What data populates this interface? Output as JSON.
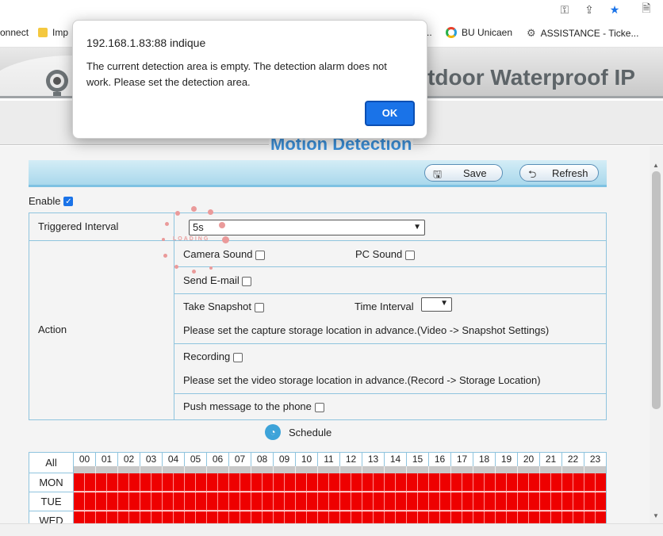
{
  "browser": {
    "bookmarks": [
      "onnect",
      "Imp",
      "..",
      "BU Unicaen",
      "ASSISTANCE - Ticke..."
    ],
    "accent": "#1a73e8"
  },
  "header": {
    "title": "utdoor Waterproof IP"
  },
  "section": {
    "title": "Motion Detection"
  },
  "toolbar": {
    "save_label": "Save",
    "refresh_label": "Refresh"
  },
  "form": {
    "enable_label": "Enable",
    "enable_checked": true,
    "triggered_interval_label": "Triggered Interval",
    "triggered_interval_value": "5s",
    "action_label": "Action",
    "camera_sound_label": "Camera Sound",
    "pc_sound_label": "PC Sound",
    "send_email_label": "Send E-mail",
    "take_snapshot_label": "Take Snapshot",
    "time_interval_label": "Time Interval",
    "snapshot_note": "Please set the capture storage location in advance.(Video -> Snapshot Settings)",
    "recording_label": "Recording",
    "recording_note": "Please set the video storage location in advance.(Record -> Storage Location)",
    "push_label": "Push message to the phone",
    "loading_text": "LOADING"
  },
  "schedule": {
    "title": "Schedule",
    "all_label": "All",
    "hours": [
      "00",
      "01",
      "02",
      "03",
      "04",
      "05",
      "06",
      "07",
      "08",
      "09",
      "10",
      "11",
      "12",
      "13",
      "14",
      "15",
      "16",
      "17",
      "18",
      "19",
      "20",
      "21",
      "22",
      "23"
    ],
    "days": [
      "MON",
      "TUE",
      "WED"
    ],
    "slot_color": "#ee0000"
  },
  "dialog": {
    "title": "192.168.1.83:88 indique",
    "message": "The current detection area is empty. The detection alarm does not work. Please set the detection area.",
    "ok_label": "OK"
  }
}
